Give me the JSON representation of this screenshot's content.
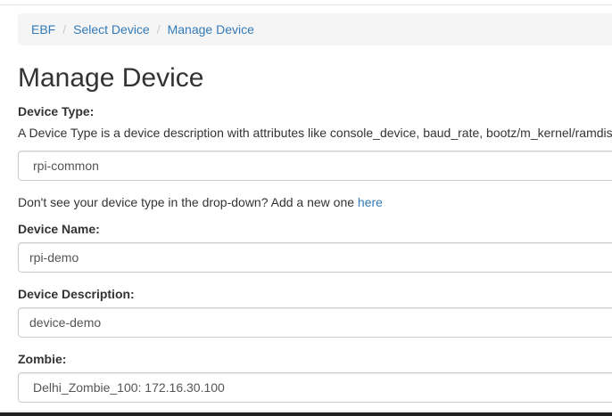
{
  "breadcrumb": {
    "items": [
      "EBF",
      "Select Device",
      "Manage Device"
    ],
    "separator": "/"
  },
  "page_title": "Manage Device",
  "device_type": {
    "label": "Device Type:",
    "description": "A Device Type is a device description with attributes like console_device, baud_rate, bootz/m_kernel/ramdisk",
    "selected": "rpi-common",
    "hint_prefix": "Don't see your device type in the drop-down? Add a new one ",
    "hint_link": "here"
  },
  "device_name": {
    "label": "Device Name:",
    "value": "rpi-demo"
  },
  "device_description": {
    "label": "Device Description:",
    "value": "device-demo"
  },
  "zombie": {
    "label": "Zombie:",
    "selected": "Delhi_Zombie_100: 172.16.30.100"
  },
  "colors": {
    "link": "#337ab7",
    "text": "#333333",
    "border": "#cccccc",
    "breadcrumb_bg": "#f5f5f5"
  }
}
